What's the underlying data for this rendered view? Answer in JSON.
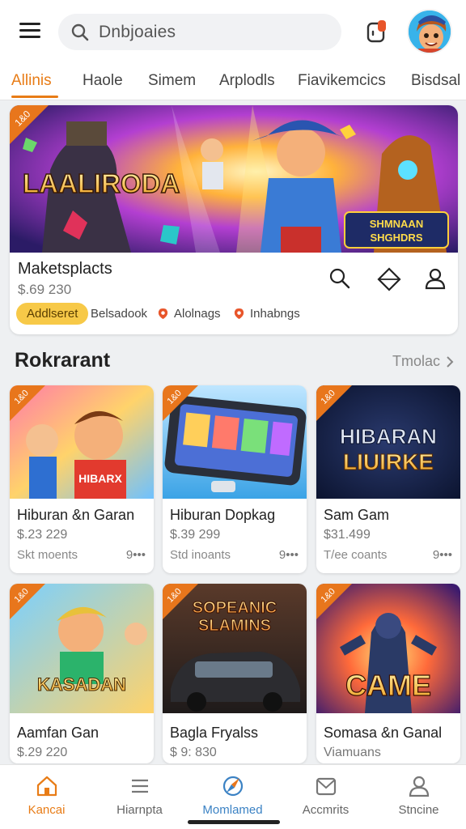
{
  "search": {
    "placeholder": "Dnbjoaies"
  },
  "tabs": [
    {
      "label": "Allinis"
    },
    {
      "label": "Haole"
    },
    {
      "label": "Simem"
    },
    {
      "label": "Arplodls"
    },
    {
      "label": "Fiavikemcics"
    },
    {
      "label": "Bisdsal"
    }
  ],
  "hero": {
    "banner_title": "LAALIRODA",
    "banner_badge": "SHMNAAN SHGHDRS",
    "title": "Maketsplacts",
    "price": "$.69 230",
    "chips": [
      {
        "label": "Addlseret"
      },
      {
        "label": "Belsadook"
      },
      {
        "label": "Alolnags"
      },
      {
        "label": "Inhabngs"
      }
    ]
  },
  "section": {
    "title": "Rokrarant",
    "more": "Tmolac"
  },
  "cards": [
    {
      "title": "Hiburan &n Garan",
      "price": "$.23 229",
      "sub": "Skt moents",
      "dots": "9•••",
      "art_text": "HIBARX"
    },
    {
      "title": "Hiburan Dopkag",
      "price": "$.39 299",
      "sub": "Std inoants",
      "dots": "9•••",
      "art_text": ""
    },
    {
      "title": "Sam Gam",
      "price": "$31.499",
      "sub": "T/ee coants",
      "dots": "9•••",
      "art_text": "HIBARAN LIUIRKE"
    },
    {
      "title": "Aamfan Gan",
      "price": "$.29 220",
      "sub": "",
      "dots": "",
      "art_text": "KASADAN"
    },
    {
      "title": "Bagla Fryalss",
      "price": "$ 9: 830",
      "sub": "",
      "dots": "",
      "art_text": "SOPEANIC SLAMINS"
    },
    {
      "title": "Somasa &n Ganal",
      "price": "Viamuans",
      "sub": "",
      "dots": "",
      "art_text": "CAME"
    }
  ],
  "badge_text": "1&0",
  "nav": [
    {
      "label": "Kancai"
    },
    {
      "label": "Hiarnpta"
    },
    {
      "label": "Momlamed"
    },
    {
      "label": "Accmrits"
    },
    {
      "label": "Stncine"
    }
  ],
  "colors": {
    "accent": "#e87c16",
    "pill": "#f7c948",
    "link": "#3b82c4"
  }
}
